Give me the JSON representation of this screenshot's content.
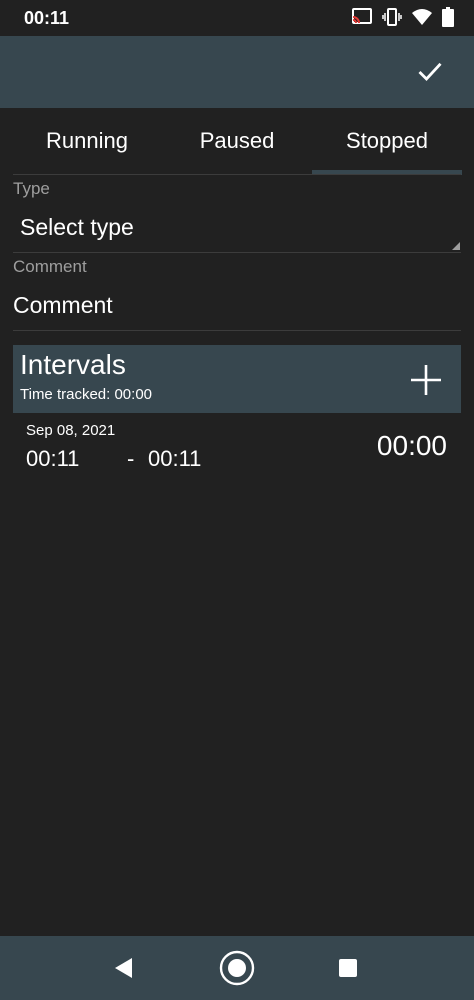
{
  "status_bar": {
    "time": "00:11",
    "icons": [
      "cast-icon",
      "vibrate-icon",
      "wifi-icon",
      "battery-icon"
    ]
  },
  "app_bar": {
    "confirm_icon": "check-icon"
  },
  "tabs": [
    {
      "label": "Running"
    },
    {
      "label": "Paused"
    },
    {
      "label": "Stopped",
      "selected": true
    }
  ],
  "form": {
    "type_label": "Type",
    "type_value": "Select type",
    "comment_label": "Comment",
    "comment_placeholder": "Comment"
  },
  "intervals": {
    "title": "Intervals",
    "time_tracked": "Time tracked: 00:00",
    "add_icon": "plus-icon",
    "items": [
      {
        "date": "Sep 08, 2021",
        "start": "00:11",
        "separator": "-",
        "end": "00:11",
        "duration": "00:00"
      }
    ]
  },
  "nav": {
    "back_icon": "back-icon",
    "home_icon": "home-icon",
    "recents_icon": "recents-icon"
  },
  "colors": {
    "background": "#212121",
    "primary": "#37474f",
    "text": "#ffffff",
    "hint": "#9e9e9e"
  }
}
